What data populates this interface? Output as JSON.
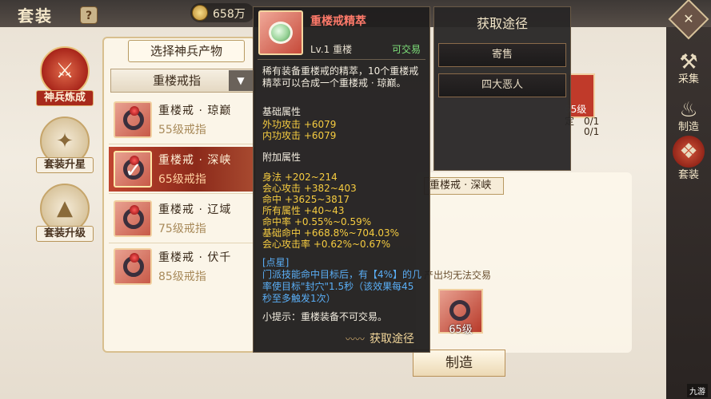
{
  "header": {
    "title": "套装",
    "help": "?",
    "currency_value": "658万"
  },
  "left_nav": [
    {
      "label": "神兵炼成",
      "glyph": "⚔",
      "active": true
    },
    {
      "label": "套装升星",
      "glyph": "✦",
      "active": false
    },
    {
      "label": "套装升级",
      "glyph": "▲",
      "active": false
    }
  ],
  "right_nav": [
    {
      "label": "采集",
      "glyph": "⚒"
    },
    {
      "label": "制造",
      "glyph": "♨"
    },
    {
      "label": "套装",
      "glyph": "❖",
      "active": true
    }
  ],
  "selector": {
    "header": "选择神兵产物",
    "dropdown_value": "重楼戒指",
    "dropdown_arrow": "▼",
    "items": [
      {
        "name": "重楼戒 · 琼巅",
        "level": "55级戒指",
        "selected": false
      },
      {
        "name": "重楼戒 · 深峡",
        "level": "65级戒指",
        "selected": true
      },
      {
        "name": "重楼戒 · 辽域",
        "level": "75级戒指",
        "selected": false
      },
      {
        "name": "重楼戒 · 伏千",
        "level": "85级戒指",
        "selected": false
      }
    ]
  },
  "tooltip": {
    "title": "重楼戒精萃",
    "lv": "Lv.1  重楼",
    "trade": "可交易",
    "desc": "稀有装备重楼戒的精萃，10个重楼戒精萃可以合成一个重楼戒 · 琼巅。",
    "base_header": "基础属性",
    "base": [
      "外功攻击 +6079",
      "内功攻击 +6079"
    ],
    "extra_header": "附加属性",
    "extra": [
      "身法 +202~214",
      "会心攻击 +382~403",
      "命中 +3625~3817",
      "所有属性 +40~43",
      "命中率 +0.55%~0.59%",
      "基础命中 +668.8%~704.03%",
      "会心攻击率 +0.62%~0.67%"
    ],
    "special": "[点星]\n门派技能命中目标后，有【4%】的几率使目标\"封穴\"1.5秒（该效果每45秒至多触发1次）",
    "tip": "小提示：重楼装备不可交易。",
    "footer": "获取途径"
  },
  "acquire": {
    "title": "获取途径",
    "options": [
      "寄售",
      "四大恶人"
    ]
  },
  "craft": {
    "selected_name": "重楼戒 · 深峡",
    "material_level": "65级",
    "material_text_1": "定",
    "material_count_1": "0/1",
    "material_count_2": "0/1",
    "notrade": "产出均无法交易",
    "result_level": "65级",
    "button": "制造"
  },
  "watermark": "九游"
}
